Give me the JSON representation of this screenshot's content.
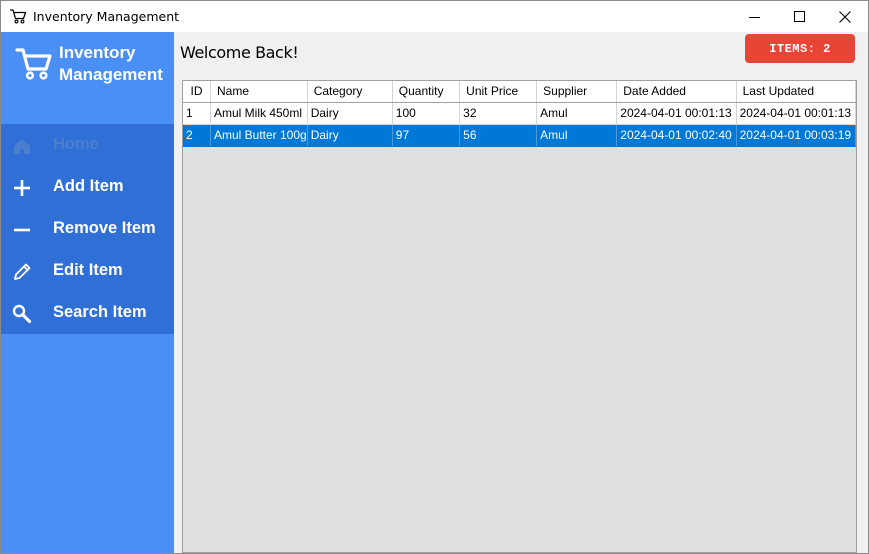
{
  "window": {
    "title": "Inventory Management",
    "controls": [
      "minimize",
      "maximize",
      "close"
    ]
  },
  "sidebar": {
    "brand_line1": "Inventory",
    "brand_line2": "Management",
    "items": [
      {
        "label": "Home",
        "icon": "home-icon",
        "active": true
      },
      {
        "label": "Add Item",
        "icon": "plus-icon"
      },
      {
        "label": "Remove Item",
        "icon": "minus-icon"
      },
      {
        "label": "Edit Item",
        "icon": "pencil-icon"
      },
      {
        "label": "Search Item",
        "icon": "search-icon"
      }
    ]
  },
  "main": {
    "welcome": "Welcome Back!",
    "items_badge": "ITEMS: 2",
    "table": {
      "columns": [
        "ID",
        "Name",
        "Category",
        "Quantity",
        "Unit Price",
        "Supplier",
        "Date Added",
        "Last Updated"
      ],
      "rows": [
        [
          "1",
          "Amul Milk 450ml",
          "Dairy",
          "100",
          "32",
          "Amul",
          "2024-04-01 00:01:13",
          "2024-04-01 00:01:13"
        ],
        [
          "2",
          "Amul Butter 100g",
          "Dairy",
          "97",
          "56",
          "Amul",
          "2024-04-01 00:02:40",
          "2024-04-01 00:03:19"
        ]
      ],
      "selected_row": 2
    }
  },
  "colors": {
    "sidebar": "#3d84ee",
    "nav_band": "#2f6fd6",
    "badge": "#e94537",
    "selection": "#0078d7"
  }
}
